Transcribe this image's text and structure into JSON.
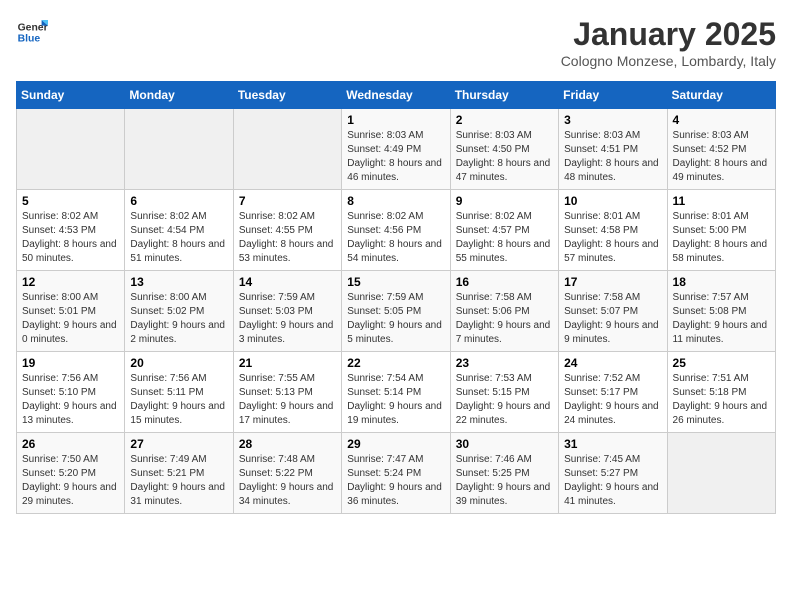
{
  "logo": {
    "general": "General",
    "blue": "Blue"
  },
  "title": {
    "month": "January 2025",
    "location": "Cologno Monzese, Lombardy, Italy"
  },
  "weekdays": [
    "Sunday",
    "Monday",
    "Tuesday",
    "Wednesday",
    "Thursday",
    "Friday",
    "Saturday"
  ],
  "weeks": [
    [
      {
        "day": "",
        "info": ""
      },
      {
        "day": "",
        "info": ""
      },
      {
        "day": "",
        "info": ""
      },
      {
        "day": "1",
        "info": "Sunrise: 8:03 AM\nSunset: 4:49 PM\nDaylight: 8 hours and 46 minutes."
      },
      {
        "day": "2",
        "info": "Sunrise: 8:03 AM\nSunset: 4:50 PM\nDaylight: 8 hours and 47 minutes."
      },
      {
        "day": "3",
        "info": "Sunrise: 8:03 AM\nSunset: 4:51 PM\nDaylight: 8 hours and 48 minutes."
      },
      {
        "day": "4",
        "info": "Sunrise: 8:03 AM\nSunset: 4:52 PM\nDaylight: 8 hours and 49 minutes."
      }
    ],
    [
      {
        "day": "5",
        "info": "Sunrise: 8:02 AM\nSunset: 4:53 PM\nDaylight: 8 hours and 50 minutes."
      },
      {
        "day": "6",
        "info": "Sunrise: 8:02 AM\nSunset: 4:54 PM\nDaylight: 8 hours and 51 minutes."
      },
      {
        "day": "7",
        "info": "Sunrise: 8:02 AM\nSunset: 4:55 PM\nDaylight: 8 hours and 53 minutes."
      },
      {
        "day": "8",
        "info": "Sunrise: 8:02 AM\nSunset: 4:56 PM\nDaylight: 8 hours and 54 minutes."
      },
      {
        "day": "9",
        "info": "Sunrise: 8:02 AM\nSunset: 4:57 PM\nDaylight: 8 hours and 55 minutes."
      },
      {
        "day": "10",
        "info": "Sunrise: 8:01 AM\nSunset: 4:58 PM\nDaylight: 8 hours and 57 minutes."
      },
      {
        "day": "11",
        "info": "Sunrise: 8:01 AM\nSunset: 5:00 PM\nDaylight: 8 hours and 58 minutes."
      }
    ],
    [
      {
        "day": "12",
        "info": "Sunrise: 8:00 AM\nSunset: 5:01 PM\nDaylight: 9 hours and 0 minutes."
      },
      {
        "day": "13",
        "info": "Sunrise: 8:00 AM\nSunset: 5:02 PM\nDaylight: 9 hours and 2 minutes."
      },
      {
        "day": "14",
        "info": "Sunrise: 7:59 AM\nSunset: 5:03 PM\nDaylight: 9 hours and 3 minutes."
      },
      {
        "day": "15",
        "info": "Sunrise: 7:59 AM\nSunset: 5:05 PM\nDaylight: 9 hours and 5 minutes."
      },
      {
        "day": "16",
        "info": "Sunrise: 7:58 AM\nSunset: 5:06 PM\nDaylight: 9 hours and 7 minutes."
      },
      {
        "day": "17",
        "info": "Sunrise: 7:58 AM\nSunset: 5:07 PM\nDaylight: 9 hours and 9 minutes."
      },
      {
        "day": "18",
        "info": "Sunrise: 7:57 AM\nSunset: 5:08 PM\nDaylight: 9 hours and 11 minutes."
      }
    ],
    [
      {
        "day": "19",
        "info": "Sunrise: 7:56 AM\nSunset: 5:10 PM\nDaylight: 9 hours and 13 minutes."
      },
      {
        "day": "20",
        "info": "Sunrise: 7:56 AM\nSunset: 5:11 PM\nDaylight: 9 hours and 15 minutes."
      },
      {
        "day": "21",
        "info": "Sunrise: 7:55 AM\nSunset: 5:13 PM\nDaylight: 9 hours and 17 minutes."
      },
      {
        "day": "22",
        "info": "Sunrise: 7:54 AM\nSunset: 5:14 PM\nDaylight: 9 hours and 19 minutes."
      },
      {
        "day": "23",
        "info": "Sunrise: 7:53 AM\nSunset: 5:15 PM\nDaylight: 9 hours and 22 minutes."
      },
      {
        "day": "24",
        "info": "Sunrise: 7:52 AM\nSunset: 5:17 PM\nDaylight: 9 hours and 24 minutes."
      },
      {
        "day": "25",
        "info": "Sunrise: 7:51 AM\nSunset: 5:18 PM\nDaylight: 9 hours and 26 minutes."
      }
    ],
    [
      {
        "day": "26",
        "info": "Sunrise: 7:50 AM\nSunset: 5:20 PM\nDaylight: 9 hours and 29 minutes."
      },
      {
        "day": "27",
        "info": "Sunrise: 7:49 AM\nSunset: 5:21 PM\nDaylight: 9 hours and 31 minutes."
      },
      {
        "day": "28",
        "info": "Sunrise: 7:48 AM\nSunset: 5:22 PM\nDaylight: 9 hours and 34 minutes."
      },
      {
        "day": "29",
        "info": "Sunrise: 7:47 AM\nSunset: 5:24 PM\nDaylight: 9 hours and 36 minutes."
      },
      {
        "day": "30",
        "info": "Sunrise: 7:46 AM\nSunset: 5:25 PM\nDaylight: 9 hours and 39 minutes."
      },
      {
        "day": "31",
        "info": "Sunrise: 7:45 AM\nSunset: 5:27 PM\nDaylight: 9 hours and 41 minutes."
      },
      {
        "day": "",
        "info": ""
      }
    ]
  ]
}
